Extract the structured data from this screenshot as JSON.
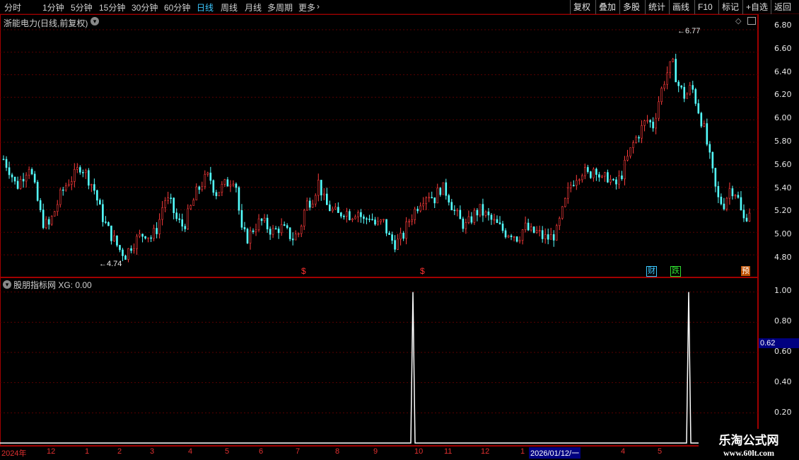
{
  "toolbar": {
    "periods": [
      "分时",
      "1分钟",
      "5分钟",
      "15分钟",
      "30分钟",
      "60分钟",
      "日线",
      "周线",
      "月线",
      "多周期",
      "更多"
    ],
    "active_period": "日线",
    "more_arrow": "›",
    "right_buttons": [
      "复权",
      "叠加",
      "多股",
      "统计",
      "画线",
      "F10",
      "标记",
      "+自选",
      "返回"
    ]
  },
  "main_panel": {
    "title": "浙能电力(日线,前复权)",
    "price_ticks": [
      "6.80",
      "6.60",
      "6.40",
      "6.20",
      "6.00",
      "5.80",
      "5.60",
      "5.40",
      "5.20",
      "5.00",
      "4.80"
    ],
    "high_label": "6.77",
    "low_label": "4.74",
    "markers": [
      {
        "text": "$",
        "color": "#ff3030"
      },
      {
        "text": "$",
        "color": "#ff3030"
      },
      {
        "text": "财",
        "color": "#3cc8ff"
      },
      {
        "text": "跌",
        "color": "#30e030"
      },
      {
        "text": "预",
        "color": "#ffffff"
      }
    ]
  },
  "indicator_panel": {
    "title": "股朋指标网",
    "series_label": "XG:",
    "series_value": "0.00",
    "ticks": [
      "1.00",
      "0.80",
      "0.60",
      "0.40",
      "0.20"
    ],
    "cursor_value": "0.62"
  },
  "date_axis": {
    "labels": [
      "2024年",
      "12",
      "1",
      "2",
      "3",
      "4",
      "5",
      "6",
      "7",
      "8",
      "9",
      "10",
      "11",
      "12",
      "1",
      "2026/01/12/一",
      "4",
      "5"
    ]
  },
  "watermark": {
    "title": "乐淘公式网",
    "url": "www.60lt.com"
  },
  "chart_data": [
    {
      "type": "candlestick",
      "title": "浙能电力(日线,前复权)",
      "ylim": [
        4.7,
        6.85
      ],
      "annotations": [
        {
          "label": "6.77",
          "type": "max"
        },
        {
          "label": "4.74",
          "type": "min"
        }
      ],
      "close_path": [
        5.65,
        5.55,
        5.4,
        5.5,
        5.6,
        5.35,
        5.1,
        5.05,
        5.2,
        5.35,
        5.45,
        5.5,
        5.6,
        5.5,
        5.4,
        5.2,
        5.05,
        4.95,
        4.85,
        4.8,
        4.9,
        4.95,
        5.0,
        4.95,
        5.05,
        5.3,
        5.25,
        5.1,
        5.05,
        5.2,
        5.35,
        5.45,
        5.5,
        5.35,
        5.4,
        5.45,
        5.5,
        5.0,
        4.95,
        5.05,
        5.1,
        5.05,
        5.0,
        5.05,
        5.0,
        4.95,
        5.0,
        5.25,
        5.3,
        5.45,
        5.25,
        5.2,
        5.15,
        5.2,
        5.15,
        5.2,
        5.1,
        5.15,
        5.05,
        5.1,
        4.95,
        4.9,
        4.95,
        5.1,
        5.2,
        5.3,
        5.35,
        5.3,
        5.4,
        5.35,
        5.2,
        5.1,
        5.05,
        5.15,
        5.2,
        5.15,
        5.1,
        5.05,
        5.0,
        5.0,
        4.95,
        5.05,
        5.0,
        5.0,
        4.95,
        4.95,
        5.0,
        5.2,
        5.4,
        5.5,
        5.55,
        5.5,
        5.6,
        5.45,
        5.5,
        5.4,
        5.5,
        5.65,
        5.8,
        5.9,
        6.0,
        5.95,
        6.2,
        6.4,
        6.5,
        6.3,
        6.2,
        6.3,
        6.1,
        5.9,
        5.6,
        5.3,
        5.25,
        5.4,
        5.35,
        5.1,
        5.2
      ]
    },
    {
      "type": "line",
      "title": "股朋指标网",
      "series": [
        {
          "name": "XG",
          "spikes": [
            {
              "date": "10",
              "value": 1.0
            },
            {
              "date": "5",
              "value": 1.0
            }
          ]
        }
      ],
      "ylim": [
        0,
        1.05
      ]
    }
  ]
}
